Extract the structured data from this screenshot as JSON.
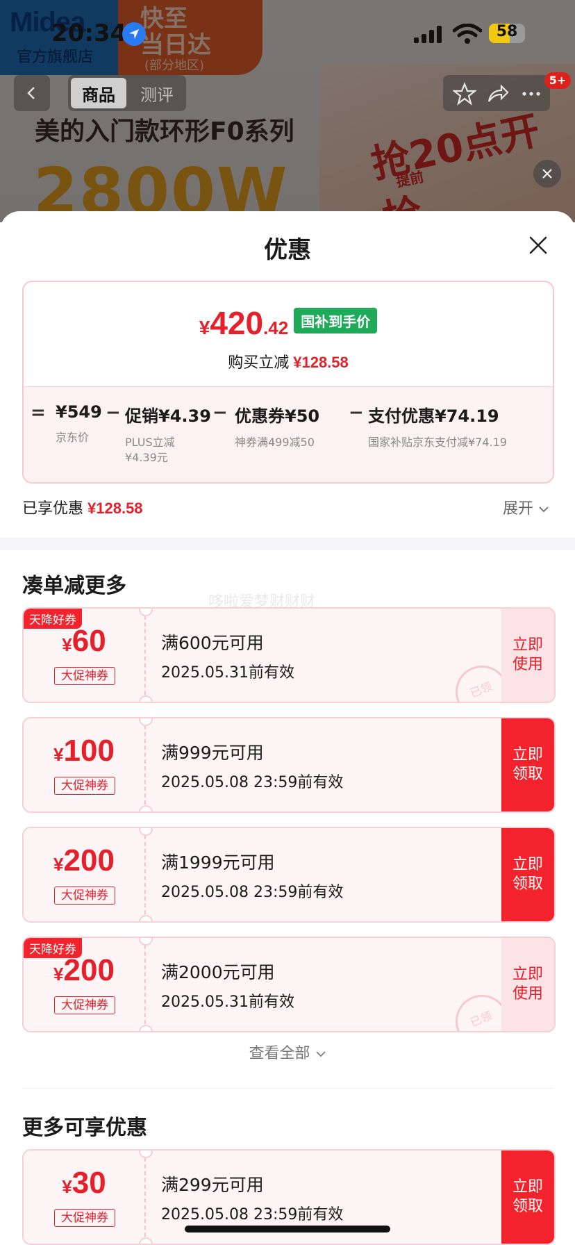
{
  "status_bar": {
    "time": "20:34",
    "battery": "58",
    "battery_level": 0.58
  },
  "background_page": {
    "store_logo": "Midea",
    "store_name": "官方旗舰店",
    "delivery_line1": "快至",
    "delivery_line2": "当日达",
    "delivery_note": "(部分地区)",
    "tab_product": "商品",
    "tab_review": "测评",
    "headline": "美的入门款环形F0系列",
    "big_text": "2800W",
    "promo_main": "抢20点开抢",
    "promo_sub": "提前",
    "badge": "5+"
  },
  "sheet": {
    "title": "优惠",
    "price": {
      "currency": "¥",
      "integer": "420",
      "decimal": ".42",
      "tag": "国补到手价"
    },
    "save_label": "购买立减",
    "save_amount": "¥128.58",
    "breakdown": {
      "eq": "=",
      "items": [
        {
          "main": "¥549",
          "sub": "京东价",
          "sub2": ""
        },
        {
          "main": "促销¥4.39",
          "sub": "PLUS立减",
          "sub2": "¥4.39元"
        },
        {
          "main": "优惠券¥50",
          "sub": "神券满499减50",
          "sub2": ""
        },
        {
          "main": "支付优惠¥74.19",
          "sub": "国家补贴京东支付减¥74.19",
          "sub2": ""
        }
      ],
      "minus": "−"
    },
    "enjoyed_label": "已享优惠",
    "enjoyed_amount": "¥128.58",
    "expand_label": "展开",
    "section1_title": "凑单减更多",
    "watermark": "哆啦爱梦财财财",
    "coupons": [
      {
        "amount": "60",
        "currency": "¥",
        "type": "大促神券",
        "condition": "满600元可用",
        "expiry": "2025.05.31前有效",
        "action": "立即\n使用",
        "tag": "天降好券",
        "stamp": "已领"
      },
      {
        "amount": "100",
        "currency": "¥",
        "type": "大促神券",
        "condition": "满999元可用",
        "expiry": "2025.05.08 23:59前有效",
        "action": "立即\n领取",
        "tag": "",
        "stamp": ""
      },
      {
        "amount": "200",
        "currency": "¥",
        "type": "大促神券",
        "condition": "满1999元可用",
        "expiry": "2025.05.08 23:59前有效",
        "action": "立即\n领取",
        "tag": "",
        "stamp": ""
      },
      {
        "amount": "200",
        "currency": "¥",
        "type": "大促神券",
        "condition": "满2000元可用",
        "expiry": "2025.05.31前有效",
        "action": "立即\n使用",
        "tag": "天降好券",
        "stamp": "已领"
      }
    ],
    "view_all": "查看全部",
    "section2_title": "更多可享优惠",
    "more_coupons": [
      {
        "amount": "30",
        "currency": "¥",
        "type": "大促神券",
        "condition": "满299元可用",
        "expiry": "2025.05.08 23:59前有效",
        "action": "立即\n领取"
      }
    ]
  },
  "colors": {
    "accent_red": "#e4202b",
    "claim_red": "#f2232c",
    "green_tag": "#1faa59"
  }
}
